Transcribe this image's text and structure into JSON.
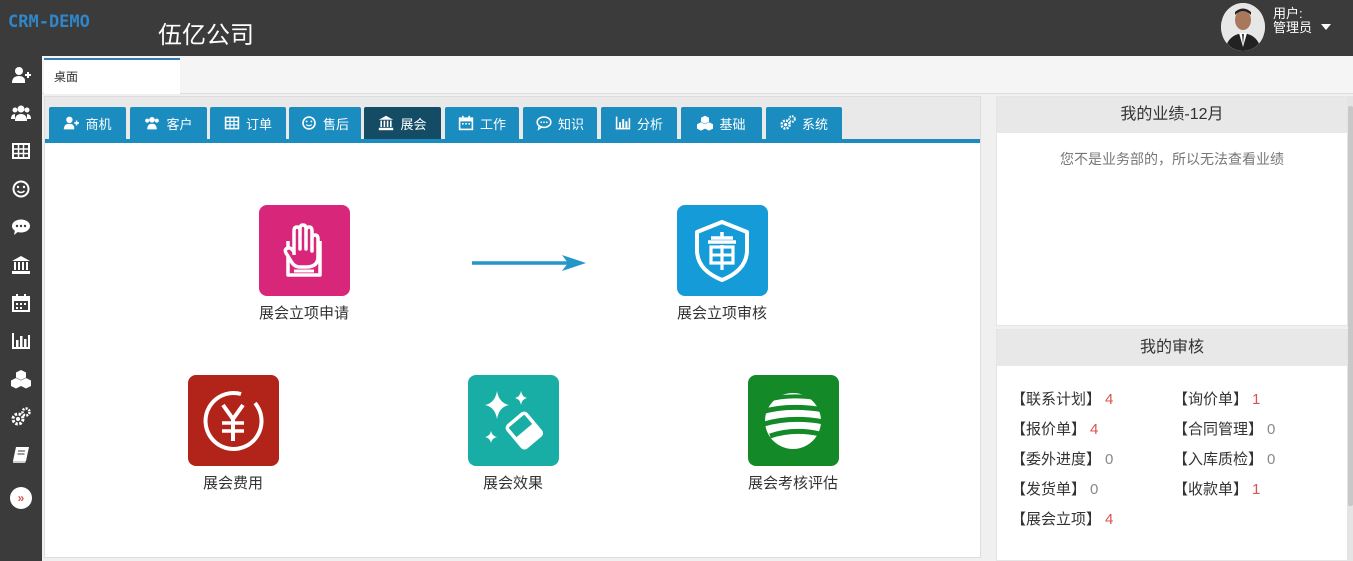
{
  "header": {
    "logo": "CRM-DEMO",
    "company": "伍亿公司",
    "user_label": "用户:",
    "user_name": "管理员"
  },
  "sidebar": {
    "icons": [
      "add-user-icon",
      "users-icon",
      "table-icon",
      "smile-icon",
      "chat-icon",
      "bank-icon",
      "calendar-icon",
      "bar-chart-icon",
      "cubes-icon",
      "gears-icon",
      "book-icon"
    ],
    "expand": "»"
  },
  "page_tab": {
    "label": "桌面"
  },
  "modules": [
    {
      "label": "商机",
      "icon": "add-user-icon"
    },
    {
      "label": "客户",
      "icon": "users-icon"
    },
    {
      "label": "订单",
      "icon": "table-icon"
    },
    {
      "label": "售后",
      "icon": "smile-icon"
    },
    {
      "label": "展会",
      "icon": "bank-icon",
      "active": true
    },
    {
      "label": "工作",
      "icon": "calendar-icon"
    },
    {
      "label": "知识",
      "icon": "chat-icon"
    },
    {
      "label": "分析",
      "icon": "bar-chart-icon"
    },
    {
      "label": "基础",
      "icon": "cubes-icon"
    },
    {
      "label": "系统",
      "icon": "gears-icon"
    }
  ],
  "apps": [
    {
      "label": "展会立项申请",
      "color": "#d8267b",
      "icon": "hand-document-icon"
    },
    {
      "label": "展会立项审核",
      "color": "#159bd7",
      "icon": "shield-approve-icon"
    },
    {
      "label": "展会费用",
      "color": "#b2241a",
      "icon": "yuan-coin-icon"
    },
    {
      "label": "展会效果",
      "color": "#19aea5",
      "icon": "sparkle-eraser-icon"
    },
    {
      "label": "展会考核评估",
      "color": "#138a27",
      "icon": "striped-globe-icon"
    }
  ],
  "performance": {
    "title": "我的业绩-12月",
    "note": "您不是业务部的，所以无法查看业绩"
  },
  "audit": {
    "title": "我的审核",
    "items": [
      {
        "label": "【联系计划】",
        "count": "4"
      },
      {
        "label": "【询价单】",
        "count": "1"
      },
      {
        "label": "【报价单】",
        "count": "4"
      },
      {
        "label": "【合同管理】",
        "count": "0"
      },
      {
        "label": "【委外进度】",
        "count": "0"
      },
      {
        "label": "【入库质检】",
        "count": "0"
      },
      {
        "label": "【发货单】",
        "count": "0"
      },
      {
        "label": "【收款单】",
        "count": "1"
      },
      {
        "label": "【展会立项】",
        "count": "4"
      }
    ]
  }
}
